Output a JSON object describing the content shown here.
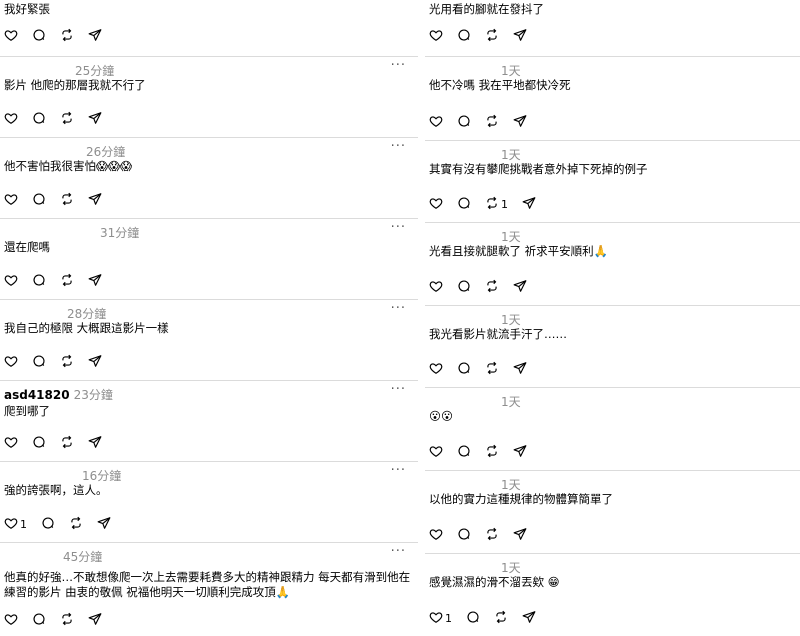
{
  "left": [
    {
      "time": "",
      "text": "我好緊張",
      "like_count": ""
    },
    {
      "time": "25分鐘",
      "text": "影片 他爬的那層我就不行了",
      "like_count": ""
    },
    {
      "time": "26分鐘",
      "text": "他不害怕我很害怕😱😱😱",
      "like_count": ""
    },
    {
      "time": "31分鐘",
      "text": "還在爬嗎",
      "like_count": ""
    },
    {
      "time": "28分鐘",
      "text": "我自己的極限 大概跟這影片一樣",
      "like_count": ""
    },
    {
      "username": "asd41820",
      "time": "23分鐘",
      "text": "爬到哪了",
      "like_count": ""
    },
    {
      "time": "16分鐘",
      "text": "強的誇張啊，這人。",
      "like_count": "1"
    },
    {
      "time": "45分鐘",
      "text": "他真的好強…不敢想像爬一次上去需要耗費多大的精神跟精力 每天都有滑到他在練習的影片 由衷的敬佩 祝福他明天一切順利完成攻頂🙏",
      "like_count": ""
    }
  ],
  "right": [
    {
      "time": "",
      "text": "光用看的腳就在發抖了",
      "like_count": "",
      "repost_count": ""
    },
    {
      "time": "1天",
      "text": "他不冷嗎 我在平地都快冷死",
      "like_count": "",
      "repost_count": ""
    },
    {
      "time": "1天",
      "text": "其實有沒有攀爬挑戰者意外掉下死掉的例子",
      "like_count": "",
      "repost_count": "1"
    },
    {
      "time": "1天",
      "text": "光看且接就腿軟了 祈求平安順利🙏",
      "like_count": "",
      "repost_count": ""
    },
    {
      "time": "1天",
      "text": "我光看影片就流手汗了……",
      "like_count": "",
      "repost_count": ""
    },
    {
      "time": "1天",
      "text": "😮😮",
      "like_count": "",
      "repost_count": ""
    },
    {
      "time": "1天",
      "text": "以他的實力這種規律的物體算簡單了",
      "like_count": "",
      "repost_count": ""
    },
    {
      "time": "1天",
      "text": "感覺濕濕的滑不溜丟欸 😁",
      "like_count": "1",
      "repost_count": ""
    }
  ],
  "icons": {
    "like": "heart-icon",
    "reply": "comment-icon",
    "repost": "repost-icon",
    "share": "share-icon",
    "more": "more-options-icon"
  },
  "more_label": "···"
}
